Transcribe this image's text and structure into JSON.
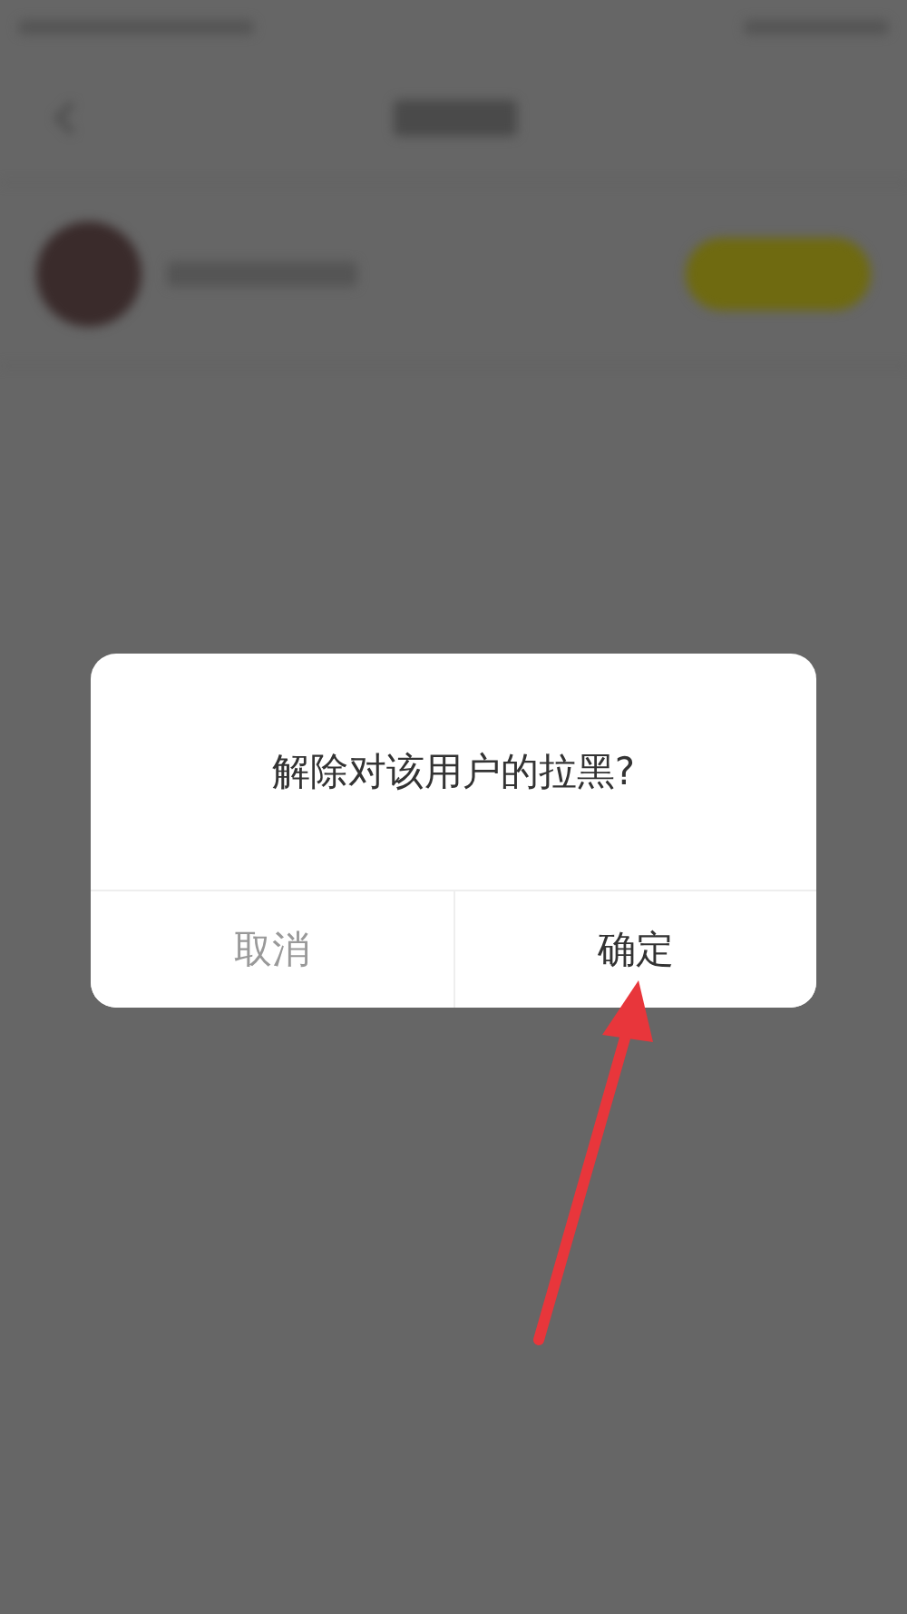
{
  "dialog": {
    "message": "解除对该用户的拉黑?",
    "buttons": [
      {
        "label": "取消",
        "kind": "cancel"
      },
      {
        "label": "确定",
        "kind": "confirm"
      }
    ]
  }
}
